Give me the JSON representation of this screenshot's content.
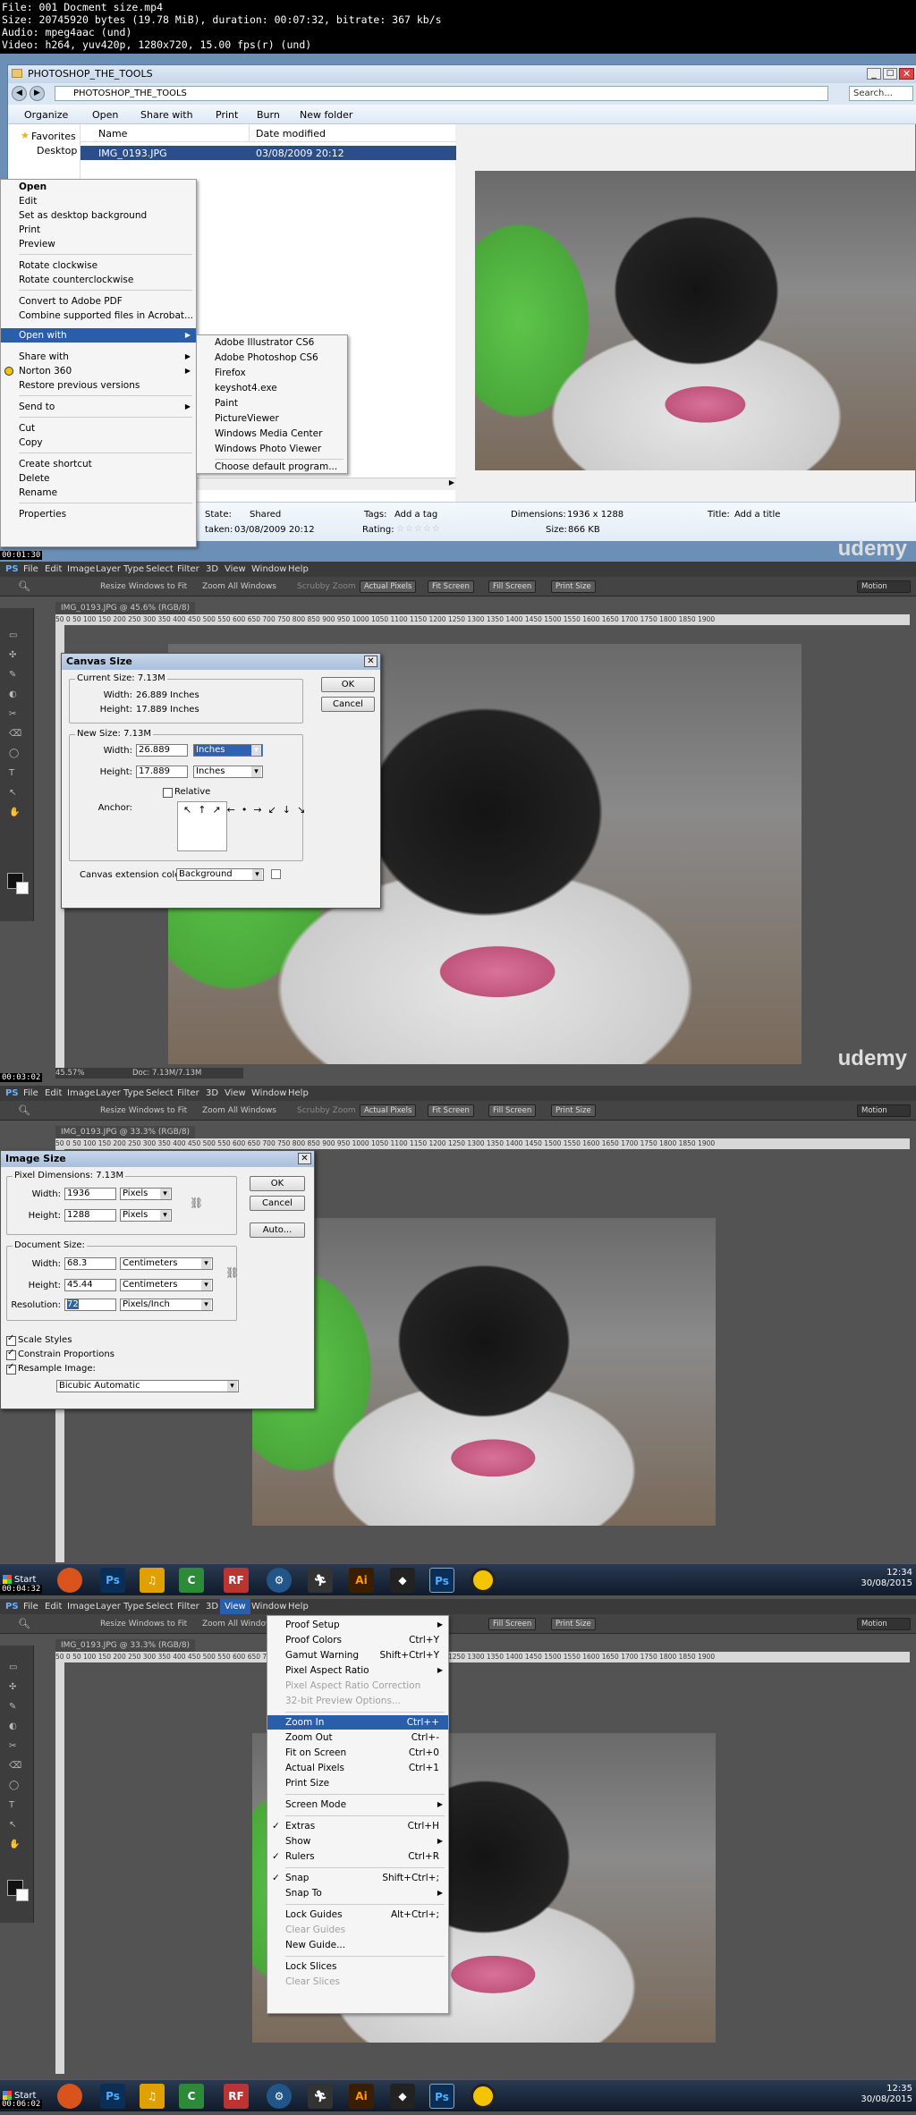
{
  "header": {
    "lines": [
      "File: 001 Docment size.mp4",
      "Size: 20745920 bytes (19.78 MiB), duration: 00:07:32, bitrate: 367 kb/s",
      "Audio: mpeg4aac (und)",
      "Video: h264, yuv420p, 1280x720, 15.00 fps(r) (und)"
    ]
  },
  "watermark": "udemy",
  "frame1": {
    "timestamp": "00:01:30",
    "window_title": "PHOTOSHOP_THE_TOOLS",
    "address": "PHOTOSHOP_THE_TOOLS",
    "search_placeholder": "Search...",
    "toolbar": [
      "Organize",
      "Open",
      "Share with",
      "Print",
      "Burn",
      "New folder"
    ],
    "nav": [
      "Favorites",
      "Desktop"
    ],
    "columns": [
      "Name",
      "Date modified"
    ],
    "file": {
      "name": "IMG_0193.JPG",
      "date": "03/08/2009 20:12"
    },
    "context_menu": [
      "Open",
      "Edit",
      "Set as desktop background",
      "Print",
      "Preview",
      "Rotate clockwise",
      "Rotate counterclockwise",
      "Convert to Adobe PDF",
      "Combine supported files in Acrobat...",
      "Open with",
      "Share with",
      "Norton 360",
      "Restore previous versions",
      "Send to",
      "Cut",
      "Copy",
      "Create shortcut",
      "Delete",
      "Rename",
      "Properties"
    ],
    "open_with": [
      "Adobe Illustrator CS6",
      "Adobe Photoshop CS6",
      "Firefox",
      "keyshot4.exe",
      "Paint",
      "PictureViewer",
      "Windows Media Center",
      "Windows Photo Viewer",
      "Choose default program..."
    ],
    "details": {
      "state_label": "State:",
      "state": "Shared",
      "tags_label": "Tags:",
      "tags": "Add a tag",
      "dims_label": "Dimensions:",
      "dims": "1936 x 1288",
      "title_label": "Title:",
      "title": "Add a title",
      "taken_label": "taken:",
      "taken": "03/08/2009 20:12",
      "rating_label": "Rating:",
      "size_label": "Size:",
      "size": "866 KB"
    }
  },
  "ps": {
    "menu": [
      "PS",
      "File",
      "Edit",
      "Image",
      "Layer",
      "Type",
      "Select",
      "Filter",
      "3D",
      "View",
      "Window",
      "Help"
    ],
    "options": [
      "Resize Windows to Fit",
      "Zoom All Windows",
      "Scrubby Zoom"
    ],
    "buttons": [
      "Actual Pixels",
      "Fit Screen",
      "Fill Screen",
      "Print Size"
    ],
    "workspace": "Motion",
    "ruler": "50 0 50 100 150 200 250 300 350 400 450 500 550 600 650 700 750 800 850 900 950 1000 1050 1100 1150 1200 1250 1300 1350 1400 1450 1500 1550 1600 1650 1700 1750 1800 1850 1900"
  },
  "frame2": {
    "timestamp": "00:03:02",
    "tab": "IMG_0193.JPG @ 45.6% (RGB/8)",
    "status": "45.57%",
    "doc": "Doc: 7.13M/7.13M",
    "dialog": {
      "title": "Canvas Size",
      "current": "Current Size: 7.13M",
      "cur_w_label": "Width:",
      "cur_w": "26.889 Inches",
      "cur_h_label": "Height:",
      "cur_h": "17.889 Inches",
      "new": "New Size: 7.13M",
      "w_label": "Width:",
      "w": "26.889",
      "w_unit": "Inches",
      "h_label": "Height:",
      "h": "17.889",
      "h_unit": "Inches",
      "relative": "Relative",
      "anchor": "Anchor:",
      "ext_label": "Canvas extension color:",
      "ext": "Background",
      "ok": "OK",
      "cancel": "Cancel"
    }
  },
  "frame3": {
    "timestamp": "00:04:32",
    "tab": "IMG_0193.JPG @ 33.3% (RGB/8)",
    "dialog": {
      "title": "Image Size",
      "pixel": "Pixel Dimensions: 7.13M",
      "pw_label": "Width:",
      "pw": "1936",
      "pw_unit": "Pixels",
      "ph_label": "Height:",
      "ph": "1288",
      "ph_unit": "Pixels",
      "doc": "Document Size:",
      "dw_label": "Width:",
      "dw": "68.3",
      "dw_unit": "Centimeters",
      "dh_label": "Height:",
      "dh": "45.44",
      "dh_unit": "Centimeters",
      "res_label": "Resolution:",
      "res": "72",
      "res_unit": "Pixels/Inch",
      "scale": "Scale Styles",
      "constrain": "Constrain Proportions",
      "resample": "Resample Image:",
      "resample_val": "Bicubic Automatic",
      "ok": "OK",
      "cancel": "Cancel",
      "auto": "Auto..."
    },
    "tray_time": "12:34",
    "tray_date": "30/08/2015"
  },
  "frame4": {
    "timestamp": "00:06:02",
    "tab": "IMG_0193.JPG @ 33.3% (RGB/8)",
    "view_menu": [
      {
        "label": "Proof Setup",
        "sc": "",
        "arrow": true
      },
      {
        "label": "Proof Colors",
        "sc": "Ctrl+Y"
      },
      {
        "label": "Gamut Warning",
        "sc": "Shift+Ctrl+Y"
      },
      {
        "label": "Pixel Aspect Ratio",
        "sc": "",
        "arrow": true
      },
      {
        "label": "Pixel Aspect Ratio Correction",
        "sc": "",
        "dis": true
      },
      {
        "label": "32-bit Preview Options...",
        "sc": "",
        "dis": true
      },
      {
        "label": "Zoom In",
        "sc": "Ctrl++",
        "sel": true
      },
      {
        "label": "Zoom Out",
        "sc": "Ctrl+-"
      },
      {
        "label": "Fit on Screen",
        "sc": "Ctrl+0"
      },
      {
        "label": "Actual Pixels",
        "sc": "Ctrl+1"
      },
      {
        "label": "Print Size",
        "sc": ""
      },
      {
        "label": "Screen Mode",
        "sc": "",
        "arrow": true
      },
      {
        "label": "Extras",
        "sc": "Ctrl+H",
        "check": true
      },
      {
        "label": "Show",
        "sc": "",
        "arrow": true
      },
      {
        "label": "Rulers",
        "sc": "Ctrl+R",
        "check": true
      },
      {
        "label": "Snap",
        "sc": "Shift+Ctrl+;",
        "check": true
      },
      {
        "label": "Snap To",
        "sc": "",
        "arrow": true
      },
      {
        "label": "Lock Guides",
        "sc": "Alt+Ctrl+;"
      },
      {
        "label": "Clear Guides",
        "sc": "",
        "dis": true
      },
      {
        "label": "New Guide...",
        "sc": ""
      },
      {
        "label": "Lock Slices",
        "sc": ""
      },
      {
        "label": "Clear Slices",
        "sc": "",
        "dis": true
      }
    ],
    "tray_time": "12:35",
    "tray_date": "30/08/2015"
  },
  "taskbar": {
    "start": "Start",
    "icons": [
      "Firefox",
      "Ps",
      "Audio",
      "Camtasia",
      "RF",
      "Settings",
      "Run",
      "Ai",
      "Unity",
      "Ps",
      "Norton"
    ]
  }
}
